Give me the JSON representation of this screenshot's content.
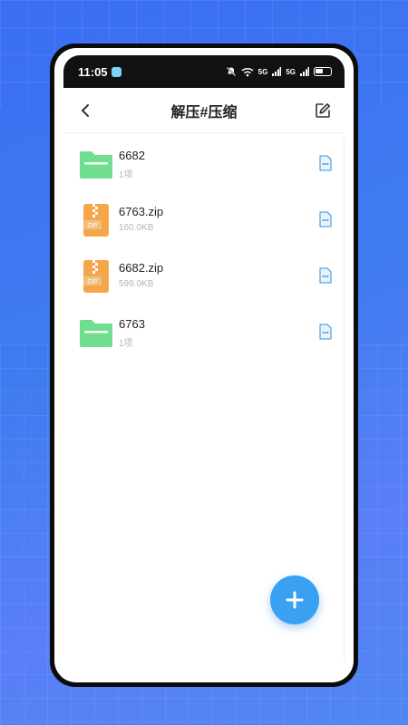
{
  "status_bar": {
    "time": "11:05",
    "network_1": "5G",
    "network_2": "5G"
  },
  "header": {
    "title": "解压#压缩"
  },
  "files": [
    {
      "name": "6682",
      "meta": "1项",
      "type": "folder"
    },
    {
      "name": "6763.zip",
      "meta": "160.0KB",
      "type": "zip"
    },
    {
      "name": "6682.zip",
      "meta": "599.0KB",
      "type": "zip"
    },
    {
      "name": "6763",
      "meta": "1项",
      "type": "folder"
    }
  ],
  "zip_label": "ZIP",
  "colors": {
    "background": "#3b6ef2",
    "folder": "#6fde8f",
    "zip": "#f5a64a",
    "fab": "#3aa0f3"
  },
  "icons": {
    "back": "chevron-left-icon",
    "edit": "edit-icon",
    "more": "file-more-icon",
    "fab": "plus-icon"
  }
}
